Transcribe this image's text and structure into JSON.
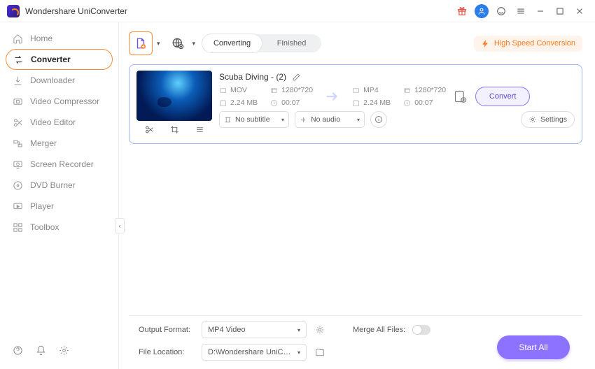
{
  "app": {
    "title": "Wondershare UniConverter"
  },
  "sidebar": {
    "items": [
      {
        "label": "Home"
      },
      {
        "label": "Converter"
      },
      {
        "label": "Downloader"
      },
      {
        "label": "Video Compressor"
      },
      {
        "label": "Video Editor"
      },
      {
        "label": "Merger"
      },
      {
        "label": "Screen Recorder"
      },
      {
        "label": "DVD Burner"
      },
      {
        "label": "Player"
      },
      {
        "label": "Toolbox"
      }
    ]
  },
  "tabs": {
    "converting": "Converting",
    "finished": "Finished"
  },
  "hsc_label": "High Speed Conversion",
  "file": {
    "name": "Scuba Diving - (2)",
    "src": {
      "format": "MOV",
      "resolution": "1280*720",
      "size": "2.24 MB",
      "duration": "00:07"
    },
    "dst": {
      "format": "MP4",
      "resolution": "1280*720",
      "size": "2.24 MB",
      "duration": "00:07"
    },
    "subtitle": "No subtitle",
    "audio": "No audio",
    "settings_label": "Settings",
    "convert_label": "Convert"
  },
  "footer": {
    "output_format_label": "Output Format:",
    "output_format_value": "MP4 Video",
    "file_location_label": "File Location:",
    "file_location_value": "D:\\Wondershare UniConverter",
    "merge_label": "Merge All Files:",
    "start_all": "Start All"
  }
}
